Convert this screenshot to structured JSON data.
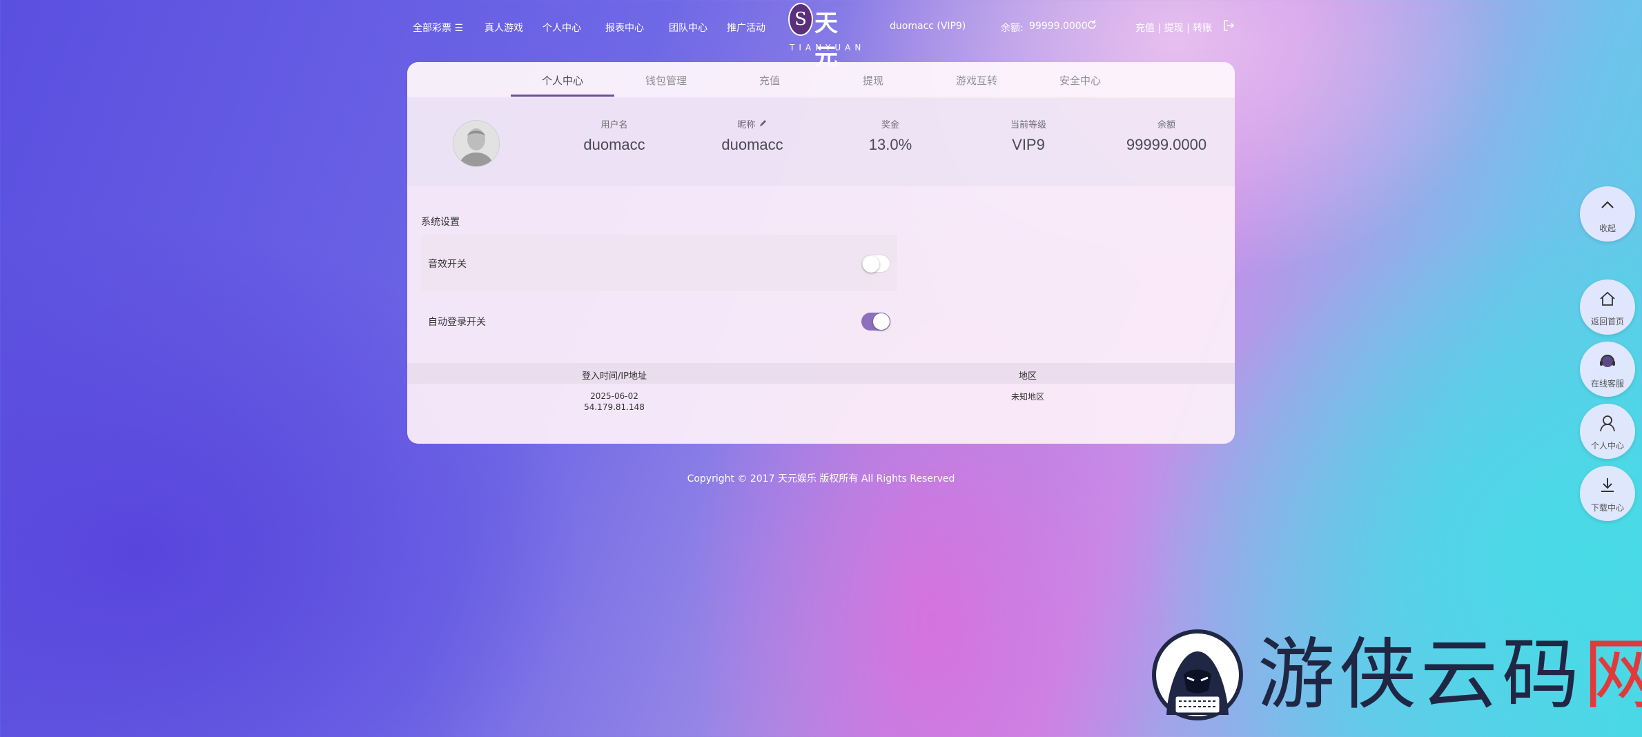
{
  "topnav": {
    "lottery": "全部彩票 ☰",
    "live": "真人游戏",
    "personal": "个人中心",
    "reports": "报表中心",
    "team": "团队中心",
    "promo": "推广活动",
    "logo_cn": "天元",
    "logo_en": "TIANYUAN",
    "user": "duomacc (VIP9)",
    "balance_label": "余额:",
    "balance_value": "99999.0000",
    "account_links": "充值 | 提现 | 转账"
  },
  "tabs": [
    "个人中心",
    "钱包管理",
    "充值",
    "提现",
    "游戏互转",
    "安全中心"
  ],
  "active_tab": "个人中心",
  "profile": {
    "username_label": "用户名",
    "username": "duomacc",
    "nickname_label": "昵称",
    "nickname": "duomacc",
    "bonus_label": "奖金",
    "bonus": "13.0%",
    "level_label": "当前等级",
    "level": "VIP9",
    "balance_label": "余额",
    "balance": "99999.0000"
  },
  "settings": {
    "title": "系统设置",
    "sound_label": "音效开关",
    "sound_on": false,
    "auto_login_label": "自动登录开关",
    "auto_login_on": true
  },
  "login_table": {
    "col1": "登入时间/IP地址",
    "col2": "地区",
    "rows": [
      {
        "date": "2025-06-02",
        "ip": "54.179.81.148",
        "region": "未知地区"
      }
    ]
  },
  "footer": "Copyright © 2017 天元娱乐 版权所有 All Rights Reserved",
  "side_buttons": {
    "collapse": "收起",
    "home": "返回首页",
    "support": "在线客服",
    "personal": "个人中心",
    "download": "下载中心"
  },
  "watermark": {
    "text_main": "游侠云码",
    "text_red": "网"
  },
  "colors": {
    "accent": "#6d4e9e",
    "toggle_on": "#8e6fbe"
  }
}
